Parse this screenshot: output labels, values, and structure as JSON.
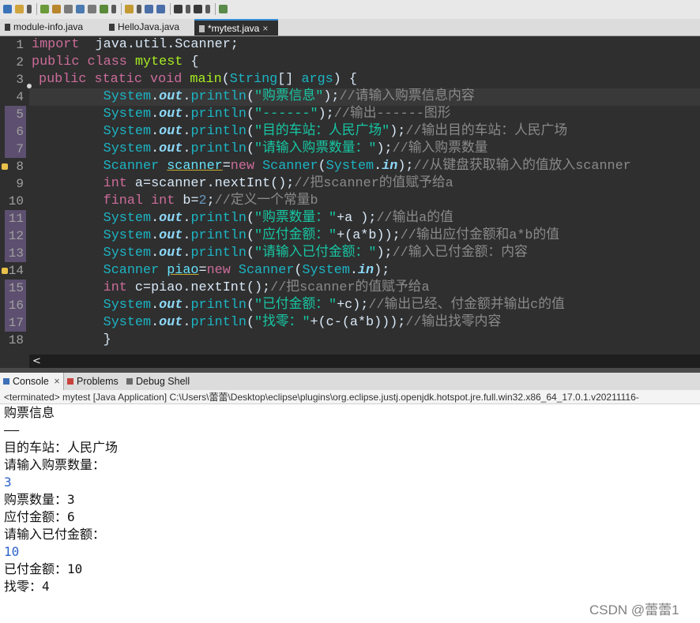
{
  "tabs": [
    {
      "label": "module-info.java",
      "active": false
    },
    {
      "label": "HelloJava.java",
      "active": false
    },
    {
      "label": "*mytest.java",
      "active": true,
      "close": "×"
    }
  ],
  "editor": {
    "current_line": 4,
    "highlighted_lines": [
      5,
      6,
      7,
      11,
      12,
      13,
      15,
      16,
      17
    ],
    "warning_lines": [
      8,
      14
    ],
    "fold_marker_line": 3,
    "lines": [
      {
        "n": "1",
        "segs": [
          [
            "k",
            "import"
          ],
          [
            "",
            "  java.util.Scanner;"
          ]
        ]
      },
      {
        "n": "2",
        "segs": [
          [
            "k",
            "public"
          ],
          [
            "",
            " "
          ],
          [
            "k",
            "class"
          ],
          [
            "",
            " "
          ],
          [
            "fm",
            "mytest"
          ],
          [
            "",
            " {"
          ]
        ]
      },
      {
        "n": "3",
        "segs": [
          [
            "",
            ""
          ],
          [
            "k",
            "public"
          ],
          [
            "",
            " "
          ],
          [
            "k",
            "static"
          ],
          [
            "",
            " "
          ],
          [
            "k",
            "void"
          ],
          [
            "",
            " "
          ],
          [
            "fm",
            "main"
          ],
          [
            "",
            "("
          ],
          [
            "cn",
            "String"
          ],
          [
            "",
            "[] "
          ],
          [
            "cn",
            "args"
          ],
          [
            "",
            ") {"
          ]
        ]
      },
      {
        "n": "4",
        "segs": [
          [
            "",
            "         "
          ],
          [
            "cn",
            "System"
          ],
          [
            "",
            "."
          ],
          [
            "fi",
            "out"
          ],
          [
            "",
            "."
          ],
          [
            "cn",
            "println"
          ],
          [
            "",
            "("
          ],
          [
            "st",
            "\"购票信息\""
          ],
          [
            "",
            ");"
          ],
          [
            "cm",
            "//请输入购票信息内容"
          ]
        ]
      },
      {
        "n": "5",
        "segs": [
          [
            "",
            "         "
          ],
          [
            "cn",
            "System"
          ],
          [
            "",
            "."
          ],
          [
            "fi",
            "out"
          ],
          [
            "",
            "."
          ],
          [
            "cn",
            "println"
          ],
          [
            "",
            "("
          ],
          [
            "st",
            "\"------\""
          ],
          [
            "",
            ");"
          ],
          [
            "cm",
            "//输出------图形"
          ]
        ]
      },
      {
        "n": "6",
        "segs": [
          [
            "",
            "         "
          ],
          [
            "cn",
            "System"
          ],
          [
            "",
            "."
          ],
          [
            "fi",
            "out"
          ],
          [
            "",
            "."
          ],
          [
            "cn",
            "println"
          ],
          [
            "",
            "("
          ],
          [
            "st",
            "\"目的车站：人民广场\""
          ],
          [
            "",
            ");"
          ],
          [
            "cm",
            "//输出目的车站：人民广场"
          ]
        ]
      },
      {
        "n": "7",
        "segs": [
          [
            "",
            "         "
          ],
          [
            "cn",
            "System"
          ],
          [
            "",
            "."
          ],
          [
            "fi",
            "out"
          ],
          [
            "",
            "."
          ],
          [
            "cn",
            "println"
          ],
          [
            "",
            "("
          ],
          [
            "st",
            "\"请输入购票数量：\""
          ],
          [
            "",
            ");"
          ],
          [
            "cm",
            "//输入购票数量"
          ]
        ]
      },
      {
        "n": "8",
        "segs": [
          [
            "",
            "         "
          ],
          [
            "cn",
            "Scanner"
          ],
          [
            "",
            " "
          ],
          [
            "wv",
            "scanner"
          ],
          [
            "",
            "="
          ],
          [
            "k",
            "new"
          ],
          [
            "",
            " "
          ],
          [
            "cn",
            "Scanner"
          ],
          [
            "",
            "("
          ],
          [
            "cn",
            "System"
          ],
          [
            "",
            "."
          ],
          [
            "fi",
            "in"
          ],
          [
            "",
            ");"
          ],
          [
            "cm",
            "//从键盘获取输入的值放入scanner"
          ]
        ]
      },
      {
        "n": "9",
        "segs": [
          [
            "",
            "         "
          ],
          [
            "k",
            "int"
          ],
          [
            "",
            " a=scanner.nextInt();"
          ],
          [
            "cm",
            "//把scanner的值赋予给a"
          ]
        ]
      },
      {
        "n": "10",
        "segs": [
          [
            "",
            "         "
          ],
          [
            "k",
            "final"
          ],
          [
            "",
            " "
          ],
          [
            "k",
            "int"
          ],
          [
            "",
            " b="
          ],
          [
            "num",
            "2"
          ],
          [
            "",
            ";"
          ],
          [
            "cm",
            "//定义一个常量b"
          ]
        ]
      },
      {
        "n": "11",
        "segs": [
          [
            "",
            "         "
          ],
          [
            "cn",
            "System"
          ],
          [
            "",
            "."
          ],
          [
            "fi",
            "out"
          ],
          [
            "",
            "."
          ],
          [
            "cn",
            "println"
          ],
          [
            "",
            "("
          ],
          [
            "st",
            "\"购票数量：\""
          ],
          [
            "",
            "+a );"
          ],
          [
            "cm",
            "//输出a的值"
          ]
        ]
      },
      {
        "n": "12",
        "segs": [
          [
            "",
            "         "
          ],
          [
            "cn",
            "System"
          ],
          [
            "",
            "."
          ],
          [
            "fi",
            "out"
          ],
          [
            "",
            "."
          ],
          [
            "cn",
            "println"
          ],
          [
            "",
            "("
          ],
          [
            "st",
            "\"应付金额：\""
          ],
          [
            "",
            "+(a*b));"
          ],
          [
            "cm",
            "//输出应付金额和a*b的值"
          ]
        ]
      },
      {
        "n": "13",
        "segs": [
          [
            "",
            "         "
          ],
          [
            "cn",
            "System"
          ],
          [
            "",
            "."
          ],
          [
            "fi",
            "out"
          ],
          [
            "",
            "."
          ],
          [
            "cn",
            "println"
          ],
          [
            "",
            "("
          ],
          [
            "st",
            "\"请输入已付金额：\""
          ],
          [
            "",
            ");"
          ],
          [
            "cm",
            "//输入已付金额：内容"
          ]
        ]
      },
      {
        "n": "14",
        "segs": [
          [
            "",
            "         "
          ],
          [
            "cn",
            "Scanner"
          ],
          [
            "",
            " "
          ],
          [
            "wv",
            "piao"
          ],
          [
            "",
            "="
          ],
          [
            "k",
            "new"
          ],
          [
            "",
            " "
          ],
          [
            "cn",
            "Scanner"
          ],
          [
            "",
            "("
          ],
          [
            "cn",
            "System"
          ],
          [
            "",
            "."
          ],
          [
            "fi",
            "in"
          ],
          [
            "",
            ");"
          ]
        ]
      },
      {
        "n": "15",
        "segs": [
          [
            "",
            "         "
          ],
          [
            "k",
            "int"
          ],
          [
            "",
            " c=piao.nextInt();"
          ],
          [
            "cm",
            "//把scanner的值赋予给a"
          ]
        ]
      },
      {
        "n": "16",
        "segs": [
          [
            "",
            "         "
          ],
          [
            "cn",
            "System"
          ],
          [
            "",
            "."
          ],
          [
            "fi",
            "out"
          ],
          [
            "",
            "."
          ],
          [
            "cn",
            "println"
          ],
          [
            "",
            "("
          ],
          [
            "st",
            "\"已付金额：\""
          ],
          [
            "",
            "+c);"
          ],
          [
            "cm",
            "//输出已经、付金额并输出c的值"
          ]
        ]
      },
      {
        "n": "17",
        "segs": [
          [
            "",
            "         "
          ],
          [
            "cn",
            "System"
          ],
          [
            "",
            "."
          ],
          [
            "fi",
            "out"
          ],
          [
            "",
            "."
          ],
          [
            "cn",
            "println"
          ],
          [
            "",
            "("
          ],
          [
            "st",
            "\"找零：\""
          ],
          [
            "",
            "+(c-(a*b)));"
          ],
          [
            "cm",
            "//输出找零内容"
          ]
        ]
      },
      {
        "n": "18",
        "segs": [
          [
            "",
            "         }"
          ]
        ]
      }
    ],
    "scroll_left_glyph": "<"
  },
  "console_tabs": {
    "console": "Console",
    "console_close": "×",
    "problems": "Problems",
    "debug_shell": "Debug Shell"
  },
  "terminated_line": "<terminated> mytest [Java Application] C:\\Users\\蕾蕾\\Desktop\\eclipse\\plugins\\org.eclipse.justj.openjdk.hotspot.jre.full.win32.x86_64_17.0.1.v20211116-",
  "console_output": [
    {
      "text": "购票信息",
      "input": false
    },
    {
      "text": "——",
      "input": false
    },
    {
      "text": "目的车站：人民广场",
      "input": false
    },
    {
      "text": "请输入购票数量：",
      "input": false
    },
    {
      "text": "3",
      "input": true
    },
    {
      "text": "购票数量：3",
      "input": false
    },
    {
      "text": "应付金额：6",
      "input": false
    },
    {
      "text": "请输入已付金额：",
      "input": false
    },
    {
      "text": "10",
      "input": true
    },
    {
      "text": "已付金额：10",
      "input": false
    },
    {
      "text": "找零：4",
      "input": false
    }
  ],
  "watermark": "CSDN @蕾蕾1",
  "toolbar_icons": [
    "save-icon",
    "pencil-icon",
    "dropdown-icon",
    "debug-icon",
    "edit-icon",
    "toggle-icon",
    "layout-icon",
    "toggle-icon",
    "new-icon",
    "dropdown-icon",
    "open-icon",
    "dropdown-icon",
    "back-icon",
    "forward-icon",
    "nav-left-icon",
    "dropdown-icon",
    "nav-right-icon",
    "dropdown-icon",
    "pin-icon"
  ],
  "colors": {
    "editor_bg": "#2f2f2f",
    "keyword": "#cc6c9a",
    "class_name": "#1cb4c4",
    "field": "#8dd8f8",
    "method_decl": "#a7ec21",
    "string": "#17c6a3",
    "comment": "#8a8a8a",
    "console_input": "#2a62c9",
    "line_highlight": "#5c4f6f"
  }
}
